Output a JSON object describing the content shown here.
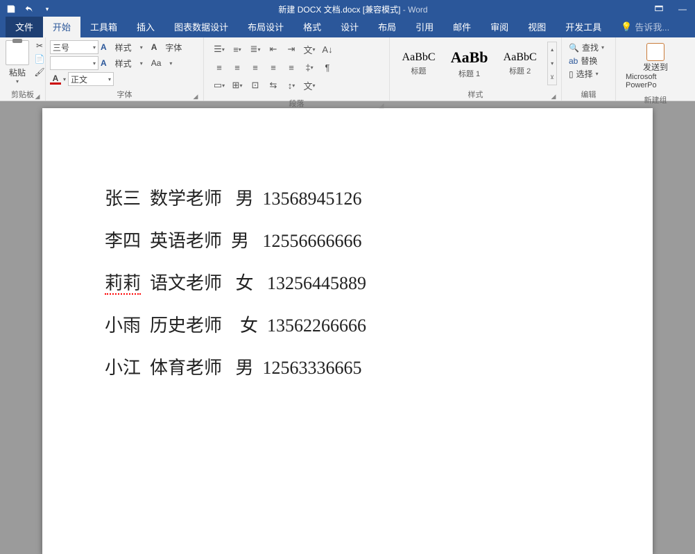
{
  "title": {
    "prefix": "新建 DOCX 文档.docx [兼容模式]",
    "suffix": " - Word"
  },
  "tabs": {
    "file": "文件",
    "home": "开始",
    "toolbox": "工具箱",
    "insert": "插入",
    "chartdata": "图表数据设计",
    "layout": "布局设计",
    "format": "格式",
    "design": "设计",
    "pagelayout": "布局",
    "references": "引用",
    "mail": "邮件",
    "review": "审阅",
    "view": "视图",
    "devtools": "开发工具",
    "tellme": "告诉我..."
  },
  "ribbon": {
    "clipboard": {
      "paste": "粘贴",
      "label": "剪贴板"
    },
    "font": {
      "size": "三号",
      "style_select": "正文",
      "style_btn": "样式",
      "char_btn": "字体",
      "aa": "Aa",
      "label": "字体"
    },
    "paragraph": {
      "label": "段落"
    },
    "styles": {
      "label": "样式",
      "cards": [
        {
          "preview": "AaBbC",
          "name": "标题",
          "cls": "normal"
        },
        {
          "preview": "AaBb",
          "name": "标题 1",
          "cls": "h1"
        },
        {
          "preview": "AaBbC",
          "name": "标题 2",
          "cls": "h2"
        }
      ]
    },
    "editing": {
      "find": "查找",
      "replace": "替换",
      "select": "选择",
      "label": "编辑"
    },
    "send": {
      "btn": "发送到",
      "sub": "Microsoft PowerPo",
      "label": "新建组"
    }
  },
  "document": {
    "lines": [
      {
        "name": "张三",
        "subject": "数学老师",
        "gender": "男",
        "phone": "13568945126",
        "spell": false
      },
      {
        "name": "李四",
        "subject": "英语老师",
        "gender": "男",
        "phone": "12556666666",
        "spell": false
      },
      {
        "name": "莉莉",
        "subject": "语文老师",
        "gender": "女",
        "phone": "13256445889",
        "spell": true
      },
      {
        "name": "小雨",
        "subject": "历史老师",
        "gender": "女",
        "phone": "13562266666",
        "spell": false
      },
      {
        "name": "小江",
        "subject": "体育老师",
        "gender": "男",
        "phone": "12563336665",
        "spell": false
      }
    ],
    "raw": [
      "张三  数学老师   男  13568945126",
      "李四  英语老师  男   12556666666",
      "莉莉  语文老师   女   13256445889",
      "小雨  历史老师    女  13562266666",
      "小江  体育老师   男  12563336665"
    ]
  }
}
